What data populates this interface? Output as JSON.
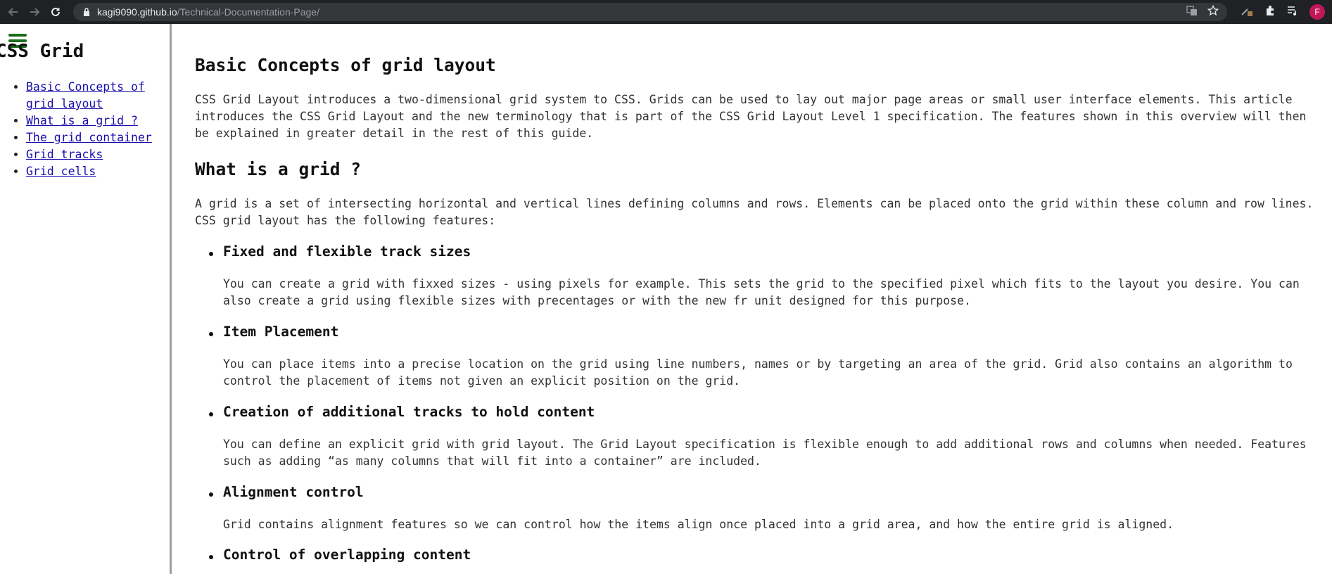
{
  "browser": {
    "url_host": "kagi9090.github.io",
    "url_path": "/Technical-Documentation-Page/",
    "avatar_letter": "F"
  },
  "sidebar": {
    "title": "CSS Grid",
    "items": [
      {
        "label": "Basic Concepts of grid layout"
      },
      {
        "label": "What is a grid ?"
      },
      {
        "label": "The grid container"
      },
      {
        "label": "Grid tracks"
      },
      {
        "label": "Grid cells"
      }
    ]
  },
  "main": {
    "basic": {
      "title": "Basic Concepts of grid layout",
      "text": "CSS Grid Layout introduces a two-dimensional grid system to CSS. Grids can be used to lay out major page areas or small user interface elements. This article introduces the CSS Grid Layout and the new terminology that is part of the CSS Grid Layout Level 1 specification. The features shown in this overview will then be explained in greater detail in the rest of this guide."
    },
    "what": {
      "title": "What is a grid ?",
      "text": "A grid is a set of intersecting horizontal and vertical lines defining columns and rows. Elements can be placed onto the grid within these column and row lines. CSS grid layout has the following features:"
    },
    "features": [
      {
        "title": "Fixed and flexible track sizes",
        "text": "You can create a grid with fixxed sizes - using pixels for example. This sets the grid to the specified pixel which fits to the layout you desire. You can also create a grid using flexible sizes with precentages or with the new fr unit designed for this purpose."
      },
      {
        "title": "Item Placement",
        "text": "You can place items into a precise location on the grid using line numbers, names or by targeting an area of the grid. Grid also contains an algorithm to control the placement of items not given an explicit position on the grid."
      },
      {
        "title": "Creation of additional tracks to hold content",
        "text": "You can define an explicit grid with grid layout. The Grid Layout specification is flexible enough to add additional rows and columns when needed. Features such as adding “as many columns that will fit into a container” are included."
      },
      {
        "title": "Alignment control",
        "text": "Grid contains alignment features so we can control how the items align once placed into a grid area, and how the entire grid is aligned."
      },
      {
        "title": "Control of overlapping content",
        "text": ""
      }
    ]
  }
}
